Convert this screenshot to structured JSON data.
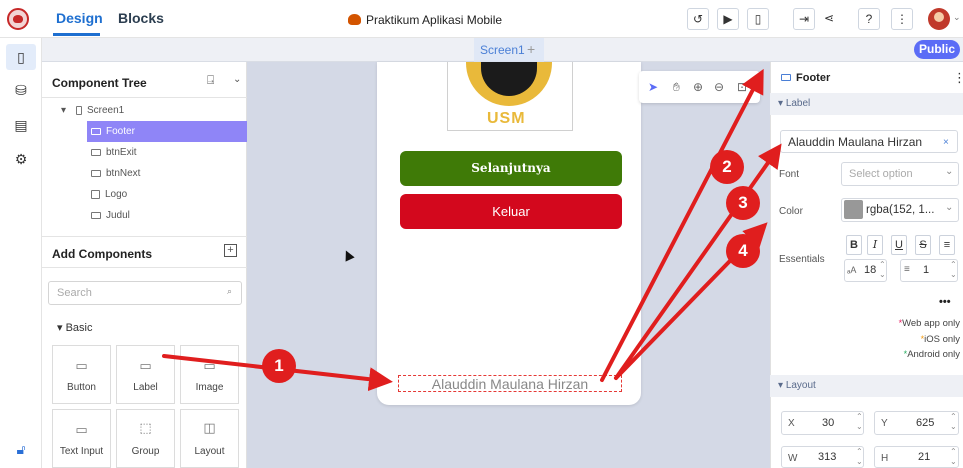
{
  "header": {
    "tabs": [
      "Design",
      "Blocks"
    ],
    "project_title": "Praktikum Aplikasi Mobile",
    "toolbar_icons": [
      "history-icon",
      "preview-icon",
      "device-preview-icon",
      "export-icon",
      "share-icon",
      "help-icon",
      "more-icon"
    ]
  },
  "screen_bar": {
    "screen_name": "Screen1",
    "add_label": "+",
    "public_label": "Public"
  },
  "component_tree": {
    "title": "Component Tree",
    "root": "Screen1",
    "items": [
      "Footer",
      "btnExit",
      "btnNext",
      "Logo",
      "Judul"
    ],
    "selected": "Footer"
  },
  "add_components": {
    "title": "Add Components",
    "search_placeholder": "Search",
    "category": "Basic",
    "items": [
      "Button",
      "Label",
      "Image",
      "Text Input",
      "Group",
      "Layout"
    ]
  },
  "canvas": {
    "logo_text": "USM",
    "next_button_label": "Selanjutnya",
    "exit_button_label": "Keluar",
    "footer_text": "Alauddin Maulana Hirzan",
    "colors": {
      "next_button": "#3f7a07",
      "exit_button": "#d3081d"
    }
  },
  "properties": {
    "component_name": "Footer",
    "label_section": "Label",
    "label_value": "Alauddin Maulana Hirzan",
    "clear_label": "×",
    "font_label": "Font",
    "font_placeholder": "Select option",
    "color_label": "Color",
    "color_value": "rgba(152, 1...",
    "color_swatch": "#989898",
    "essentials_label": "Essentials",
    "font_size": "18",
    "line_height": "1",
    "more_label": "•••",
    "notes": [
      "Web app only",
      "iOS only",
      "Android only"
    ],
    "layout_section": "Layout",
    "x_label": "X",
    "x_value": "30",
    "y_label": "Y",
    "y_value": "625",
    "w_label": "W",
    "w_value": "313",
    "h_label": "H",
    "h_value": "21"
  },
  "annotations": [
    "1",
    "2",
    "3",
    "4"
  ]
}
